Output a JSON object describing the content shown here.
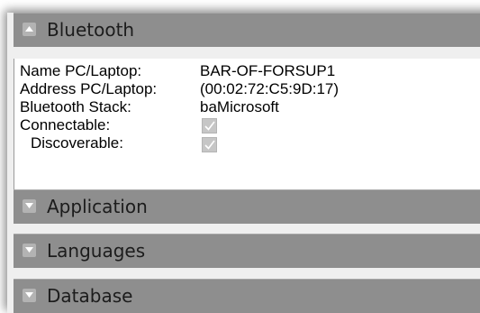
{
  "panels": [
    {
      "title": "Bluetooth",
      "state": "expanded",
      "icon": "chevron-up-icon"
    },
    {
      "title": "Application",
      "state": "collapsed",
      "icon": "chevron-down-icon"
    },
    {
      "title": "Languages",
      "state": "collapsed",
      "icon": "chevron-down-icon"
    },
    {
      "title": "Database",
      "state": "collapsed",
      "icon": "chevron-down-icon"
    }
  ],
  "bluetooth": {
    "name_label": "Name PC/Laptop:",
    "name_value": "BAR-OF-FORSUP1",
    "address_label": "Address PC/Laptop:",
    "address_value": "(00:02:72:C5:9D:17)",
    "stack_label": "Bluetooth Stack:",
    "stack_value": "baMicrosoft",
    "connectable_label": "Connectable:",
    "connectable_checked": true,
    "discoverable_label": "Discoverable:",
    "discoverable_checked": true
  },
  "colors": {
    "header_bg": "#8e8e8e",
    "panel_bg": "#efefef",
    "checkbox_bg": "#c6c6c6"
  }
}
